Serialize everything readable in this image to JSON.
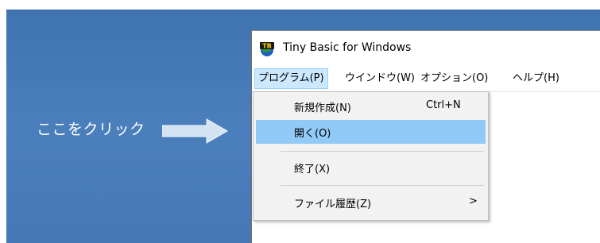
{
  "desktop": {
    "callout_text": "ここをクリック"
  },
  "window": {
    "title": "Tiny Basic for Windows",
    "icon_text": "TB"
  },
  "menubar": {
    "items": [
      {
        "label": "プログラム(P)"
      },
      {
        "label": "ウインドウ(W)"
      },
      {
        "label": "オプション(O)"
      },
      {
        "label": "ヘルプ(H)"
      }
    ]
  },
  "dropdown": {
    "items": [
      {
        "label": "新規作成(N)",
        "shortcut": "Ctrl+N"
      },
      {
        "label": "開く(O)"
      },
      {
        "label": "終了(X)"
      },
      {
        "label": "ファイル履歴(Z)",
        "submenu_arrow": ">"
      }
    ]
  },
  "colors": {
    "desktop": "#4679b7",
    "menu_active": "#cce8ff",
    "dropdown_highlight": "#91c9f7"
  }
}
